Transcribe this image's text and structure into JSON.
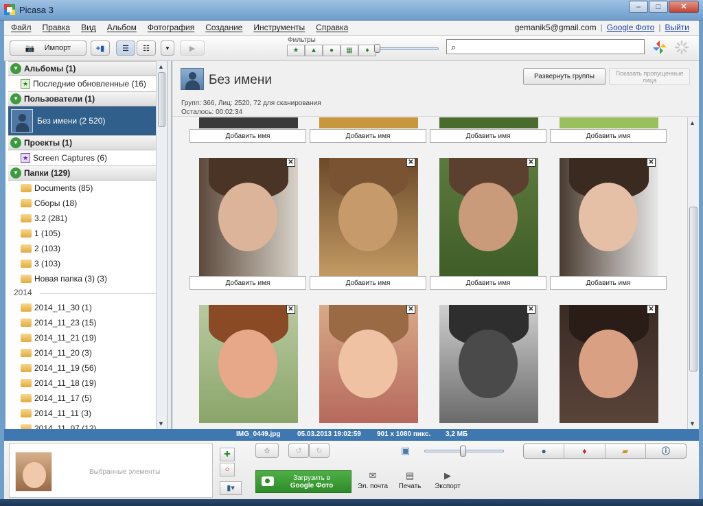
{
  "window": {
    "title": "Picasa 3",
    "minimize": "–",
    "maximize": "□",
    "close": "✕"
  },
  "menu": [
    "Файл",
    "Правка",
    "Вид",
    "Альбом",
    "Фотография",
    "Создание",
    "Инструменты",
    "Справка"
  ],
  "account": {
    "email": "gemanik5@gmail.com",
    "google_photo": "Google Фото",
    "logout": "Выйти"
  },
  "toolbar": {
    "import_label": "Импорт",
    "filters_label": "Фильтры",
    "search_placeholder": ""
  },
  "sidebar": {
    "albums": {
      "label": "Альбомы (1)",
      "items": [
        "Последние обновленные (16)"
      ]
    },
    "people": {
      "label": "Пользователи (1)",
      "items": [
        "Без имени (2 520)"
      ]
    },
    "projects": {
      "label": "Проекты (1)",
      "items": [
        "Screen Captures (6)"
      ]
    },
    "folders": {
      "label": "Папки (129)",
      "items": [
        "Documents (85)",
        "Сборы (18)",
        "3.2 (281)",
        "1 (105)",
        "2 (103)",
        "3 (103)",
        "Новая папка (3) (3)"
      ],
      "year": "2014",
      "dated": [
        "2014_11_30 (1)",
        "2014_11_23 (15)",
        "2014_11_21 (19)",
        "2014_11_20 (3)",
        "2014_11_19 (56)",
        "2014_11_18 (19)",
        "2014_11_17 (5)",
        "2014_11_11 (3)",
        "2014_11_07 (12)"
      ]
    }
  },
  "main": {
    "title": "Без имени",
    "meta_line1": "Групп: 366, Лиц: 2520, 72 для сканирования",
    "meta_line2": "Осталось: 00:02:34",
    "expand_button": "Развернуть группы",
    "missing_button": "Показать пропущенные лица",
    "add_name": "Добавить имя",
    "close_mark": "✕"
  },
  "status": {
    "filename": "IMG_0449.jpg",
    "datetime": "05.03.2013 19:02:59",
    "dimensions": "901 x 1080 пикс.",
    "size": "3,2 МБ"
  },
  "bottom": {
    "selection_label": "Выбранные элементы",
    "upload_line1": "Загрузить в",
    "upload_line2": "Google Фото",
    "email": "Эл. почта",
    "print": "Печать",
    "export": "Экспорт"
  }
}
